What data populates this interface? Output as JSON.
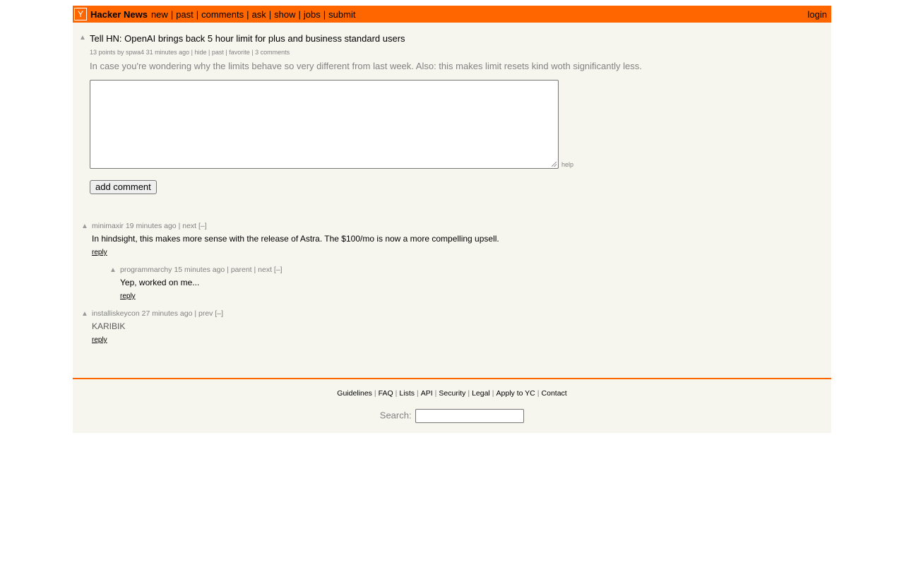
{
  "header": {
    "logo_letter": "Y",
    "site_name": "Hacker News",
    "nav": [
      "new",
      "past",
      "comments",
      "ask",
      "show",
      "jobs",
      "submit"
    ],
    "separator": "|",
    "login": "login"
  },
  "story": {
    "vote_arrow": "▲",
    "title": "Tell HN: OpenAI brings back 5 hour limit for plus and business standard users",
    "points": "13 points",
    "by_label": "by",
    "user": "spwa4",
    "age": "31 minutes ago",
    "links": [
      "hide",
      "past",
      "favorite",
      "3 comments"
    ],
    "text": "In case you're wondering why the limits behave so very different from last week. Also: this makes limit resets kind woth significantly less."
  },
  "comment_form": {
    "help": "help",
    "submit_label": "add comment"
  },
  "comments": [
    {
      "user": "minimaxir",
      "age": "19 minutes ago",
      "nav": "| next [–]",
      "text": "In hindsight, this makes more sense with the release of Astra. The $100/mo is now a more compelling upsell.",
      "reply": "reply"
    },
    {
      "user": "programmarchy",
      "age": "15 minutes ago",
      "nav": "| parent | next [–]",
      "text": "Yep, worked on me...",
      "reply": "reply"
    },
    {
      "user": "installiskeycon",
      "age": "27 minutes ago",
      "nav": "| prev [–]",
      "text": "KARIBIK",
      "reply": "reply"
    }
  ],
  "footer": {
    "links": [
      "Guidelines",
      "FAQ",
      "Lists",
      "API",
      "Security",
      "Legal",
      "Apply to YC",
      "Contact"
    ],
    "search_label": "Search:"
  },
  "colors": {
    "accent": "#ff6600",
    "background": "#f6f6ef",
    "meta_text": "#828282"
  }
}
